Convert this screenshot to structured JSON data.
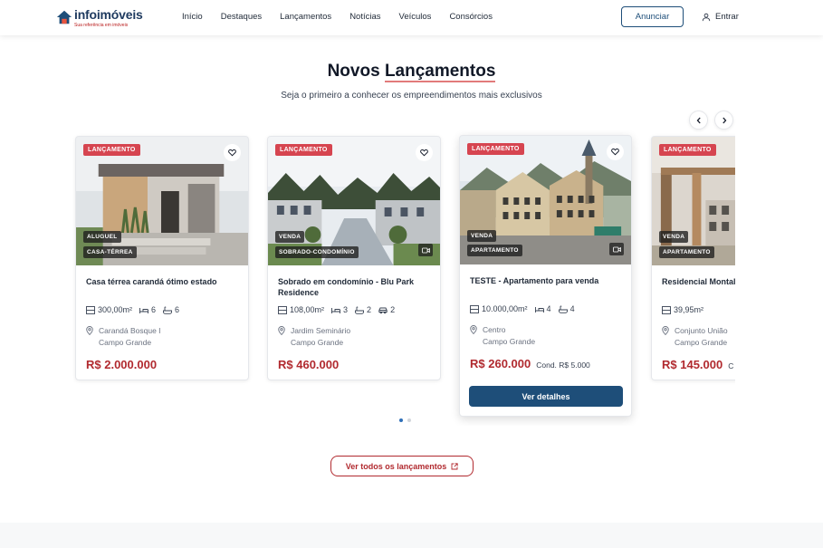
{
  "header": {
    "logo_name": "infoimóveis",
    "logo_tagline": "Sua referência em imóveis",
    "nav": [
      "Início",
      "Destaques",
      "Lançamentos",
      "Notícias",
      "Veículos",
      "Consórcios"
    ],
    "anunciar": "Anunciar",
    "entrar": "Entrar"
  },
  "section": {
    "title_part1": "Novos ",
    "title_part2": "Lançamentos",
    "subtitle": "Seja o primeiro a conhecer os empreendimentos mais exclusivos",
    "view_all": "Ver todos os lançamentos"
  },
  "cards": [
    {
      "badge": "LANÇAMENTO",
      "tag1": "ALUGUEL",
      "tag2": "CASA-TÉRREA",
      "title": "Casa térrea carandá ótimo estado",
      "area": "300,00m²",
      "beds": "6",
      "baths": "6",
      "garage": "",
      "neighborhood": "Carandá Bosque I",
      "city": "Campo Grande",
      "price": "R$ 2.000.000",
      "cond": ""
    },
    {
      "badge": "LANÇAMENTO",
      "tag1": "VENDA",
      "tag2": "SOBRADO-CONDOMÍNIO",
      "title": "Sobrado em condomínio - Blu Park Residence",
      "area": "108,00m²",
      "beds": "3",
      "baths": "2",
      "garage": "2",
      "neighborhood": "Jardim Seminário",
      "city": "Campo Grande",
      "price": "R$ 460.000",
      "cond": ""
    },
    {
      "badge": "LANÇAMENTO",
      "tag1": "VENDA",
      "tag2": "APARTAMENTO",
      "title": "TESTE - Apartamento para venda",
      "area": "10.000,00m²",
      "beds": "4",
      "baths": "4",
      "garage": "",
      "neighborhood": "Centro",
      "city": "Campo Grande",
      "price": "R$ 260.000",
      "cond": "Cond. R$ 5.000",
      "details_button": "Ver detalhes"
    },
    {
      "badge": "LANÇAMENTO",
      "tag1": "VENDA",
      "tag2": "APARTAMENTO",
      "title": "Residencial Montal em frente ao Pires",
      "area": "39,95m²",
      "beds": "",
      "baths": "",
      "garage": "",
      "neighborhood": "Conjunto União",
      "city": "Campo Grande",
      "price": "R$ 145.000",
      "cond": "C"
    }
  ],
  "carousel": {
    "pages": 2,
    "active_page": 1
  },
  "colors": {
    "brand_blue": "#1e4e79",
    "brand_red": "#b12a2f",
    "badge_red": "#d64550"
  }
}
